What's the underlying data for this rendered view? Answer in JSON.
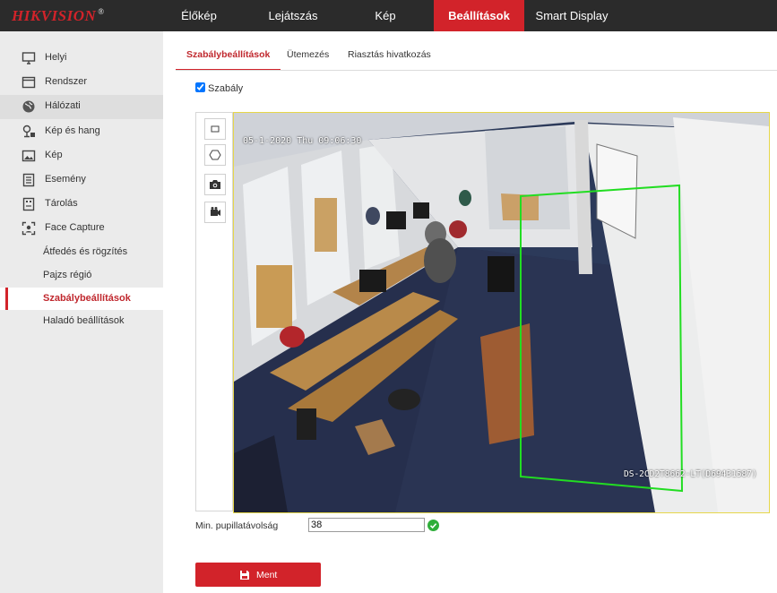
{
  "brand": {
    "name": "HIKVISION",
    "mark": "®"
  },
  "nav": {
    "tabs": [
      {
        "label": "Élőkép"
      },
      {
        "label": "Lejátszás"
      },
      {
        "label": "Kép"
      },
      {
        "label": "Beállítások",
        "active": true
      },
      {
        "label": "Smart Display"
      }
    ]
  },
  "sidebar": {
    "items": [
      {
        "label": "Helyi",
        "icon": "monitor-icon"
      },
      {
        "label": "Rendszer",
        "icon": "window-icon"
      },
      {
        "label": "Hálózati",
        "icon": "globe-icon"
      },
      {
        "label": "Kép és hang",
        "icon": "audio-video-icon"
      },
      {
        "label": "Kép",
        "icon": "image-icon"
      },
      {
        "label": "Esemény",
        "icon": "list-icon"
      },
      {
        "label": "Tárolás",
        "icon": "storage-icon"
      },
      {
        "label": "Face Capture",
        "icon": "face-capture-icon"
      }
    ],
    "subitems": [
      {
        "label": "Átfedés és rögzítés"
      },
      {
        "label": "Pajzs régió"
      },
      {
        "label": "Szabálybeállítások",
        "active": true
      },
      {
        "label": "Haladó beállítások"
      }
    ]
  },
  "subtabs": [
    {
      "label": "Szabálybeállítások",
      "active": true
    },
    {
      "label": "Ütemezés"
    },
    {
      "label": "Riasztás hivatkozás"
    }
  ],
  "rule": {
    "label": "Szabály",
    "checked": true
  },
  "tools": [
    {
      "name": "rectangle-tool",
      "icon": "rectangle-icon"
    },
    {
      "name": "polygon-tool",
      "icon": "hexagon-icon"
    },
    {
      "name": "snapshot-tool",
      "icon": "camera-icon"
    },
    {
      "name": "record-tool",
      "icon": "video-camera-icon"
    }
  ],
  "video": {
    "timestamp": "05-1-2020 Thu 09:06:30",
    "camera_name": "DS-2CD2T8662-LT(D69431587)",
    "detection_color": "#22dd22"
  },
  "min_pupil": {
    "label": "Min. pupillatávolság",
    "value": "38",
    "status_color": "#2fae3a"
  },
  "save": {
    "label": "Ment"
  },
  "colors": {
    "accent": "#d2232a",
    "topbar": "#2b2b2b",
    "sidebar": "#ebebeb"
  }
}
